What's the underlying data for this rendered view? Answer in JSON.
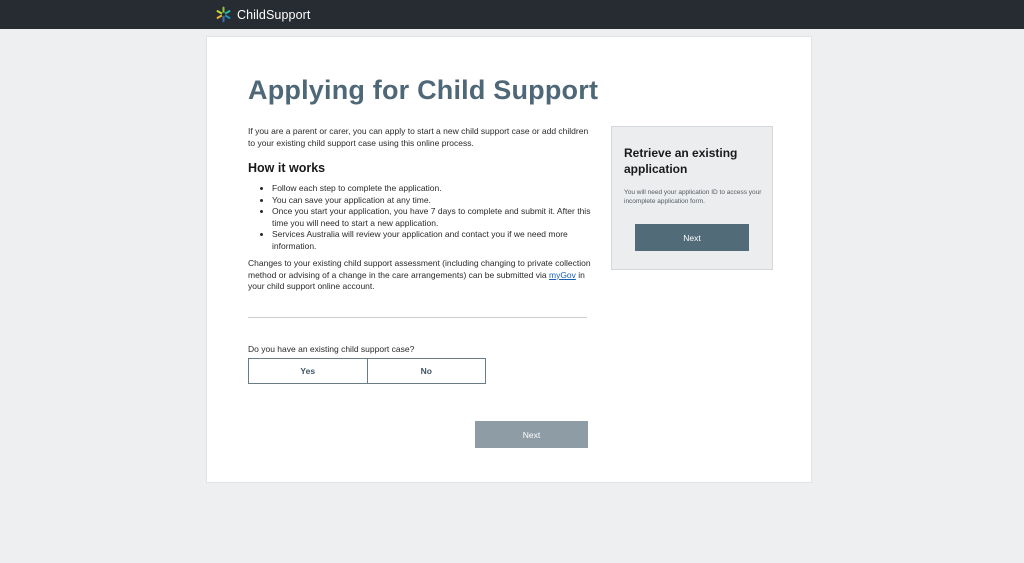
{
  "header": {
    "brand": "ChildSupport",
    "logo_icon": "childsupport-star-logo",
    "background": "#262c31"
  },
  "main": {
    "title": "Applying for Child Support",
    "intro": "If you are a parent or carer, you can apply to start a new child support case or add children to your existing child support case using this online process.",
    "how_it_works": {
      "heading": "How it works",
      "items": [
        "Follow each step to complete the application.",
        "You can save your application at any time.",
        "Once you start your application, you have 7 days to complete and submit it. After this time you will need to start a new application.",
        "Services Australia will review your application and contact you if we need more information."
      ]
    },
    "changes": {
      "text_before": "Changes to your existing child support assessment (including changing to private collection method or advising of a change in the care arrangements) can be submitted via ",
      "link": "myGov",
      "text_after": " in your child support online account."
    },
    "question": {
      "label": "Do you have an existing child support case?",
      "options": [
        "Yes",
        "No"
      ]
    },
    "next_label": "Next"
  },
  "retrieve": {
    "title": "Retrieve an existing application",
    "text": "You will need your application ID to access your incomplete application form.",
    "next_label": "Next"
  },
  "colors": {
    "title": "#4f6877",
    "primary_button": "#526b79",
    "disabled_button": "#8e9ca5",
    "link": "#1a5fb4"
  }
}
